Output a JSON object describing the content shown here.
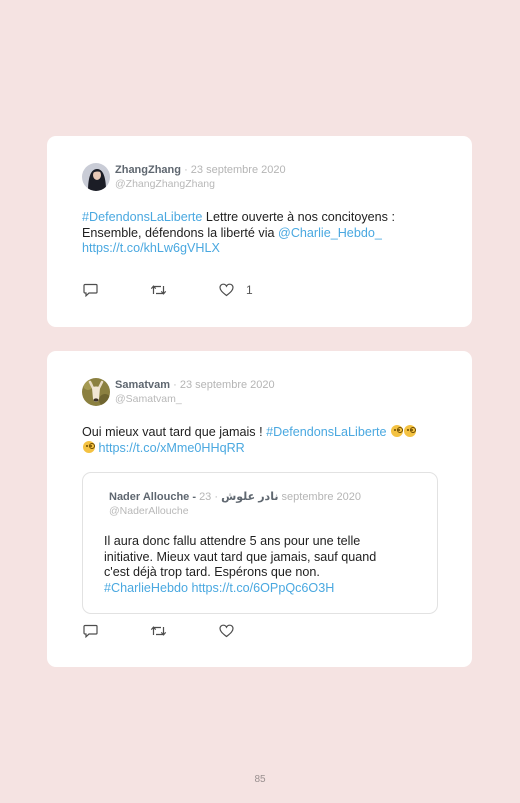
{
  "tweets": [
    {
      "username": "ZhangZhang",
      "date": "23 septembre 2020",
      "handle": "@ZhangZhangZhang",
      "text": {
        "hashtag": "#DefendonsLaLiberte",
        "line1_rest": " Lettre ouverte à nos concitoyens :",
        "line2_text": "Ensemble, défendons la liberté via ",
        "line2_link": "@Charlie_Hebdo_",
        "line3_link": "https://t.co/khLw6gVHLX"
      },
      "like_count": "1",
      "icons": [
        "reply-icon",
        "retweet-icon",
        "like-icon"
      ]
    },
    {
      "username": "Samatvam",
      "date": "23 septembre 2020",
      "handle": "@Samatvam_",
      "text": {
        "line1_text": "Oui mieux vaut tard que jamais ! ",
        "line1_hashtag": "#DefendonsLaLiberte",
        "line2_link": "https://t.co/xMme0HHqRR",
        "emojis": [
          "face-with-monocle-icon",
          "face-with-monocle-icon",
          "face-with-monocle-icon"
        ]
      },
      "quote": {
        "username": "Nader Allouche - نادر علوش",
        "date": "23 septembre 2020",
        "handle": "@NaderAllouche",
        "lines": [
          "Il aura donc fallu attendre 5 ans pour une telle",
          "initiative. Mieux vaut tard que jamais, sauf quand",
          "c'est déjà trop tard. Espérons que non."
        ],
        "hashtag": "#CharlieHebdo",
        "link": "https://t.co/6OPpQc6O3H"
      },
      "icons": [
        "reply-icon",
        "retweet-icon",
        "like-icon"
      ]
    }
  ],
  "page_number": "85",
  "colors": {
    "background": "#f5e3e2",
    "card": "#ffffff",
    "link": "#4aa8e0",
    "username": "#5f6770",
    "meta": "#b5b5b5"
  }
}
